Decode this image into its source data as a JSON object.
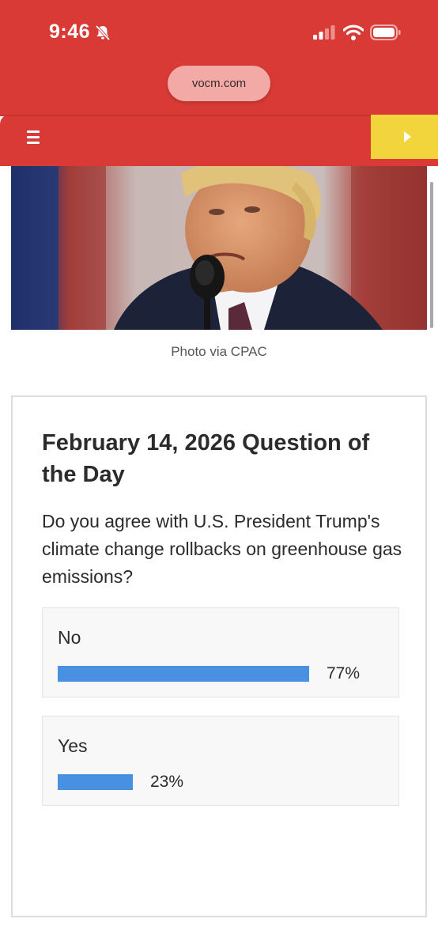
{
  "status_bar": {
    "time": "9:46",
    "icons": [
      "bell-slash-icon",
      "signal-icon",
      "wifi-icon",
      "battery-icon"
    ]
  },
  "browser": {
    "url": "vocm.com"
  },
  "site_header": {
    "menu_icon": "hamburger-menu-icon",
    "play_icon": "play-icon",
    "colors": {
      "header": "#d93a35",
      "play_button": "#f2d43c"
    }
  },
  "hero": {
    "caption": "Photo via CPAC"
  },
  "poll": {
    "title": "February 14, 2026 Question of the Day",
    "question": "Do you agree with U.S. President Trump's climate change rollbacks on greenhouse gas emissions?",
    "bar_color": "#4a90e2",
    "options": [
      {
        "label": "No",
        "percent_text": "77%",
        "percent": 77
      },
      {
        "label": "Yes",
        "percent_text": "23%",
        "percent": 23
      }
    ]
  }
}
